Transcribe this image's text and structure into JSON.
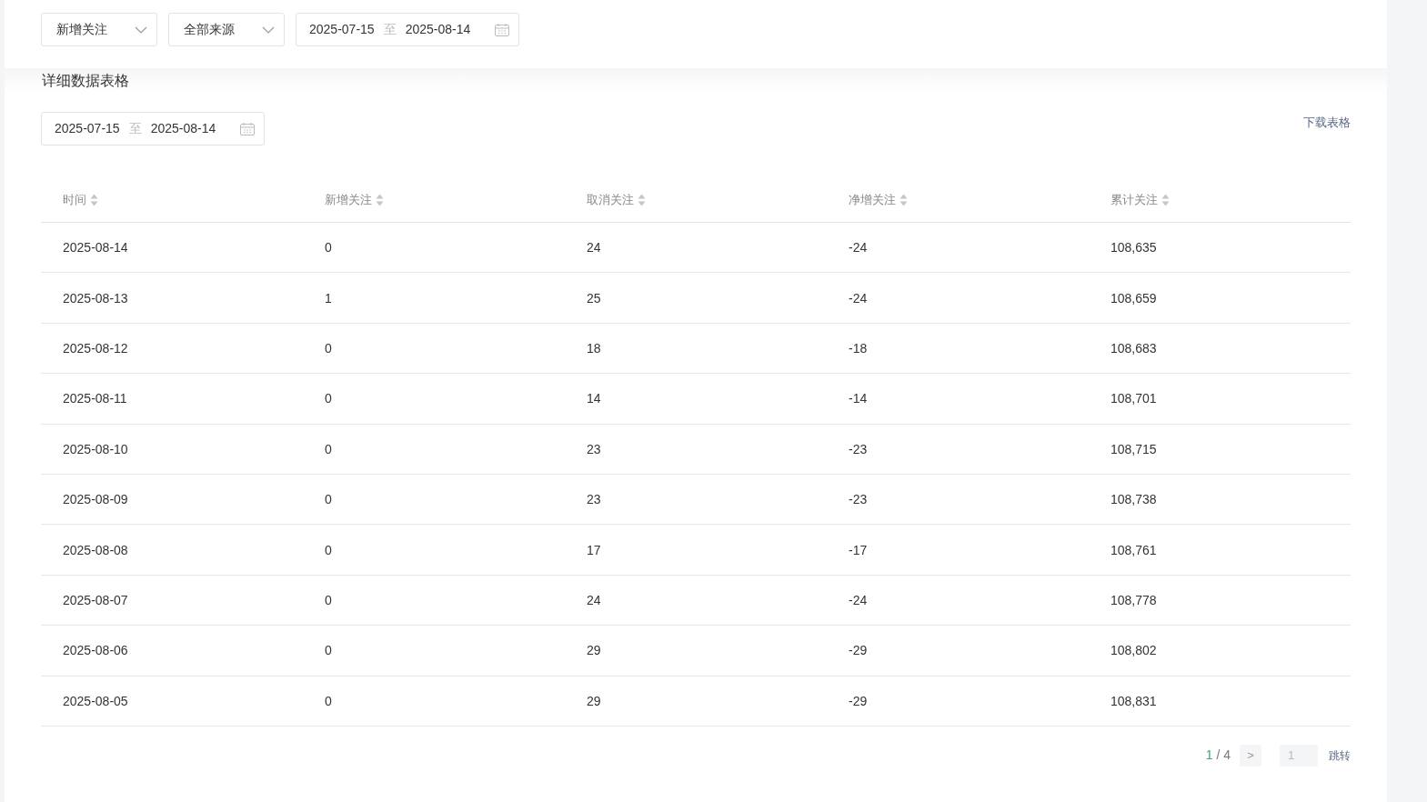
{
  "filters": {
    "metric_select": {
      "value": "新增关注"
    },
    "source_select": {
      "value": "全部来源"
    },
    "date_range": {
      "start": "2025-07-15",
      "separator": "至",
      "end": "2025-08-14"
    }
  },
  "section": {
    "title": "详细数据表格",
    "download_link": "下载表格",
    "date_range": {
      "start": "2025-07-15",
      "separator": "至",
      "end": "2025-08-14"
    }
  },
  "table": {
    "columns": [
      "时间",
      "新增关注",
      "取消关注",
      "净增关注",
      "累计关注"
    ],
    "rows": [
      [
        "2025-08-14",
        "0",
        "24",
        "-24",
        "108,635"
      ],
      [
        "2025-08-13",
        "1",
        "25",
        "-24",
        "108,659"
      ],
      [
        "2025-08-12",
        "0",
        "18",
        "-18",
        "108,683"
      ],
      [
        "2025-08-11",
        "0",
        "14",
        "-14",
        "108,701"
      ],
      [
        "2025-08-10",
        "0",
        "23",
        "-23",
        "108,715"
      ],
      [
        "2025-08-09",
        "0",
        "23",
        "-23",
        "108,738"
      ],
      [
        "2025-08-08",
        "0",
        "17",
        "-17",
        "108,761"
      ],
      [
        "2025-08-07",
        "0",
        "24",
        "-24",
        "108,778"
      ],
      [
        "2025-08-06",
        "0",
        "29",
        "-29",
        "108,802"
      ],
      [
        "2025-08-05",
        "0",
        "29",
        "-29",
        "108,831"
      ]
    ]
  },
  "pagination": {
    "current": "1",
    "total": "/ 4",
    "next": ">",
    "jump_placeholder": "1",
    "jump_button": "跳转"
  }
}
